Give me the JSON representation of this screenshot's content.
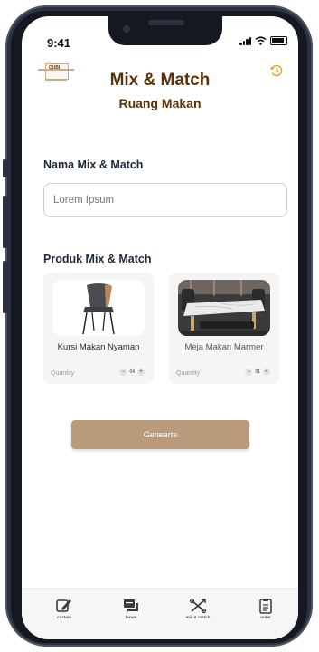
{
  "status": {
    "time": "9:41"
  },
  "header": {
    "logo_text": "CUBI",
    "title": "Mix & Match",
    "subtitle": "Ruang Makan"
  },
  "form": {
    "name_label": "Nama Mix & Match",
    "name_placeholder": "Lorem Ipsum",
    "products_label": "Produk Mix & Match"
  },
  "products": [
    {
      "name": "Kursi Makan Nyaman",
      "quantity_label": "Quantity",
      "quantity": "04",
      "minus": "−",
      "plus": "+"
    },
    {
      "name": "Meja Makan Marmer",
      "quantity_label": "Quantity",
      "quantity": "01",
      "minus": "−",
      "plus": "+"
    }
  ],
  "actions": {
    "generate_label": "Genearte"
  },
  "nav": [
    {
      "label": "custom",
      "icon": "custom-pencil-icon",
      "active": true
    },
    {
      "label": "forum",
      "icon": "forum-chat-icon"
    },
    {
      "label": "mix & match",
      "icon": "mix-match-icon"
    },
    {
      "label": "order",
      "icon": "order-clipboard-icon"
    }
  ],
  "colors": {
    "brand": "#5a320a",
    "accent": "#b99b7b",
    "history": "#e0a42a"
  }
}
